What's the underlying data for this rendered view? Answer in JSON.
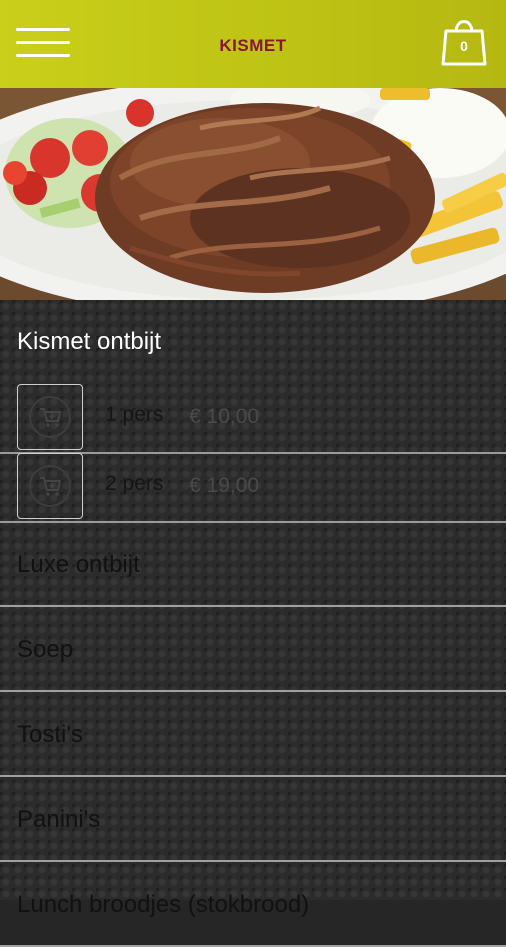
{
  "header": {
    "title": "KISMET",
    "cart_count": "0"
  },
  "sections": [
    {
      "title": "Kismet ontbijt",
      "items": [
        {
          "name": "1 pers",
          "price": "€ 10,00"
        },
        {
          "name": "2 pers",
          "price": "€ 19,00"
        }
      ]
    }
  ],
  "categories": [
    {
      "label": "Luxe ontbijt"
    },
    {
      "label": "Soep"
    },
    {
      "label": "Tosti's"
    },
    {
      "label": "Panini's"
    },
    {
      "label": "Lunch broodjes (stokbrood)"
    }
  ],
  "icons": {
    "menu": "hamburger-icon",
    "cart": "shopping-bag-icon",
    "add": "cart-add-icon"
  },
  "colors": {
    "header_bg": "#c2c816",
    "title": "#8a1537",
    "accent": "#ffffff"
  }
}
